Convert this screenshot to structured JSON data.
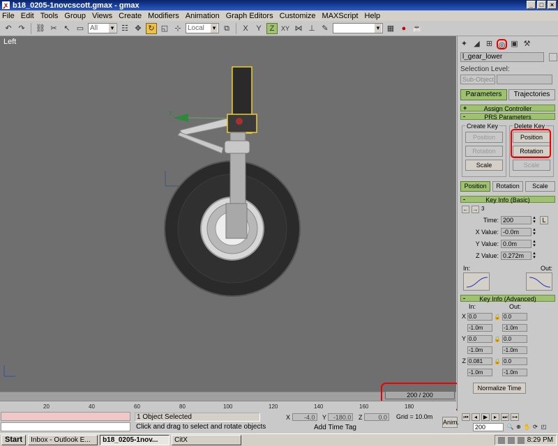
{
  "window": {
    "title": "b18_0205-1novcscott.gmax - gmax",
    "buttons": [
      "_",
      "□",
      "×"
    ]
  },
  "menu": [
    "File",
    "Edit",
    "Tools",
    "Group",
    "Views",
    "Create",
    "Modifiers",
    "Animation",
    "Graph Editors",
    "Customize",
    "MAXScript",
    "Help"
  ],
  "toolbar": {
    "filter_value": "All",
    "coord_system": "Local"
  },
  "viewport": {
    "label": "Left"
  },
  "timeline": {
    "frame_counter": "200 / 200",
    "ticks": [
      "20",
      "40",
      "60",
      "80",
      "100",
      "120",
      "140",
      "160",
      "180"
    ]
  },
  "status": {
    "selection": "1 Object Selected",
    "prompt": "Click and drag to select and rotate objects",
    "x_label": "X",
    "x_value": "-4.0",
    "y_label": "Y",
    "y_value": "-180.0",
    "z_label": "Z",
    "z_value": "0.0",
    "grid": "Grid = 10.0m",
    "add_time_tag": "Add Time Tag",
    "anim": "Anim.",
    "frame": "200"
  },
  "cmdpanel": {
    "object_name": "l_gear_lower",
    "selection_level_label": "Selection Level:",
    "sub_object": "Sub-Object",
    "tab_parameters": "Parameters",
    "tab_trajectories": "Trajectories",
    "rollout_assign": "Assign Controller",
    "rollout_prs": "PRS Parameters",
    "create_key": "Create Key",
    "delete_key": "Delete Key",
    "ck_position": "Position",
    "ck_rotation": "Rotation",
    "ck_scale": "Scale",
    "dk_position": "Position",
    "dk_rotation": "Rotation",
    "dk_scale": "Scale",
    "mode_position": "Position",
    "mode_rotation": "Rotation",
    "mode_scale": "Scale",
    "rollout_key_basic": "Key Info (Basic)",
    "key_index": "3",
    "time_label": "Time:",
    "time_value": "200",
    "lock_btn": "L",
    "xval_label": "X Value:",
    "xval": "-0.0m",
    "yval_label": "Y Value:",
    "yval": "0.0m",
    "zval_label": "Z Value:",
    "zval": "0.272m",
    "in_label": "In:",
    "out_label": "Out:",
    "rollout_key_adv": "Key Info (Advanced)",
    "adv_in": "In:",
    "adv_out": "Out:",
    "adv_rows": [
      {
        "axis": "X",
        "in": "0.0",
        "out": "0.0"
      },
      {
        "axis": "",
        "in": "-1.0m",
        "out": "-1.0m"
      },
      {
        "axis": "Y",
        "in": "0.0",
        "out": "0.0"
      },
      {
        "axis": "",
        "in": "-1.0m",
        "out": "-1.0m"
      },
      {
        "axis": "Z",
        "in": "0.081",
        "out": "0.0"
      },
      {
        "axis": "",
        "in": "-1.0m",
        "out": "-1.0m"
      }
    ],
    "normalize_time": "Normalize Time"
  },
  "taskbar": {
    "start": "Start",
    "tasks": [
      "Inbox - Outlook E...",
      "b18_0205-1nov...",
      "CitX"
    ],
    "clock": "8:29 PM"
  },
  "colors": {
    "accent_green": "#9ec270",
    "highlight_red": "#e00000",
    "viewport_bg": "#6f6f6f"
  }
}
